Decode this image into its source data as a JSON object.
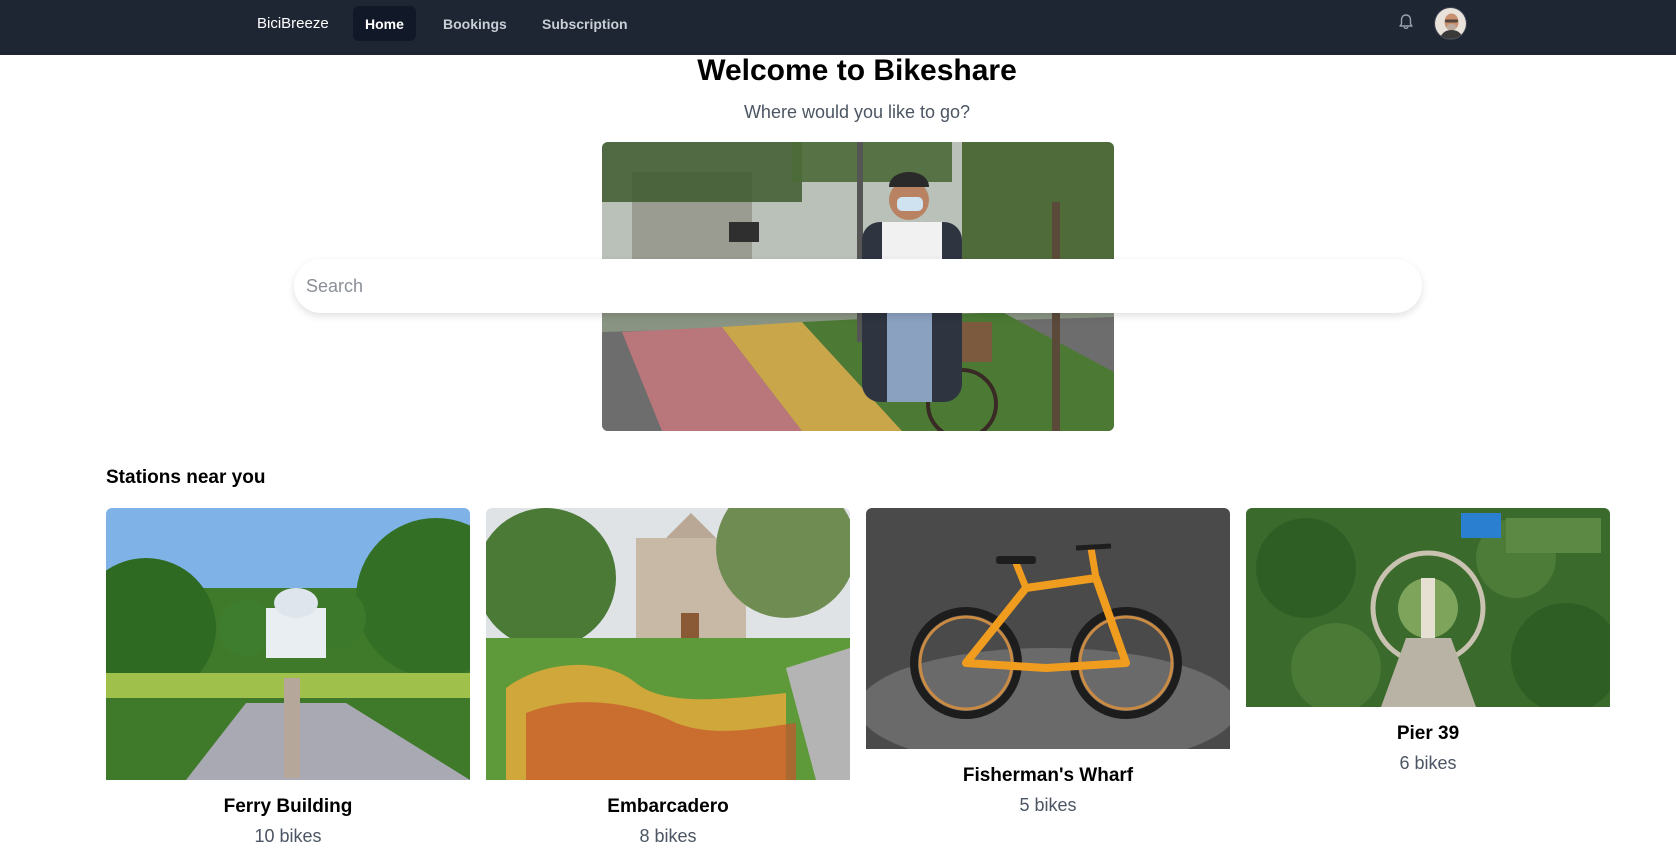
{
  "nav": {
    "brand": "BiciBreeze",
    "links": [
      {
        "label": "Home",
        "active": true
      },
      {
        "label": "Bookings",
        "active": false
      },
      {
        "label": "Subscription",
        "active": false
      }
    ],
    "bell_icon": "bell-icon",
    "avatar_icon": "user-avatar"
  },
  "hero": {
    "title": "Welcome to Bikeshare",
    "subtitle": "Where would you like to go?",
    "search_placeholder": "Search"
  },
  "stations": {
    "title": "Stations near you",
    "items": [
      {
        "name": "Ferry Building",
        "bikes": "10 bikes"
      },
      {
        "name": "Embarcadero",
        "bikes": "8 bikes"
      },
      {
        "name": "Fisherman's Wharf",
        "bikes": "5 bikes"
      },
      {
        "name": "Pier 39",
        "bikes": "6 bikes"
      }
    ]
  },
  "colors": {
    "navbar": "#1e2533",
    "active_tab": "#111827",
    "muted_text": "#4b5563"
  }
}
